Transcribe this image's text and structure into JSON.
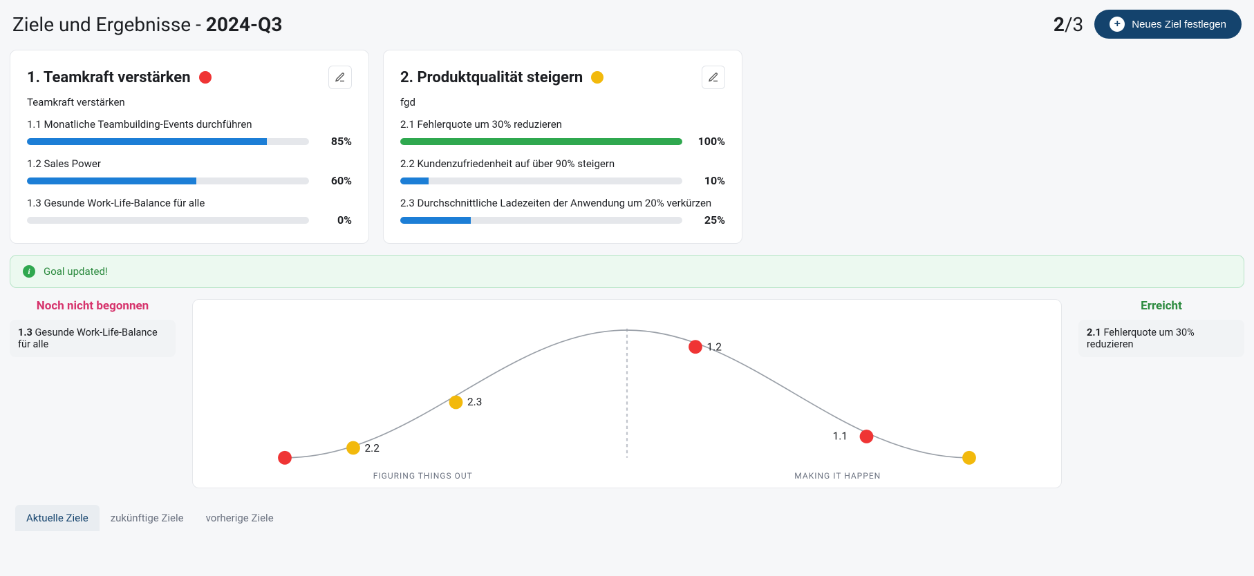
{
  "header": {
    "title_prefix": "Ziele und Ergebnisse - ",
    "period": "2024-Q3",
    "counter_num": "2",
    "counter_total": "/3",
    "new_goal_label": "Neues Ziel festlegen"
  },
  "goals": [
    {
      "title": "1. Teamkraft verstärken",
      "status_color": "red",
      "desc": "Teamkraft verstärken",
      "krs": [
        {
          "label": "1.1 Monatliche Teambuilding-Events durchführen",
          "pct": 85,
          "color": "blue"
        },
        {
          "label": "1.2 Sales Power",
          "pct": 60,
          "color": "blue"
        },
        {
          "label": "1.3 Gesunde Work-Life-Balance für alle",
          "pct": 0,
          "color": "blue"
        }
      ]
    },
    {
      "title": "2. Produktqualität steigern",
      "status_color": "yellow",
      "desc": "fgd",
      "krs": [
        {
          "label": "2.1 Fehlerquote um 30% reduzieren",
          "pct": 100,
          "color": "green"
        },
        {
          "label": "2.2 Kundenzufriedenheit auf über 90% steigern",
          "pct": 10,
          "color": "blue"
        },
        {
          "label": "2.3 Durchschnittliche Ladezeiten der Anwendung um 20% verkürzen",
          "pct": 25,
          "color": "blue"
        }
      ]
    }
  ],
  "alert": {
    "text": "Goal updated!"
  },
  "viz": {
    "not_started_title": "Noch nicht begonnen",
    "not_started_item_id": "1.3",
    "not_started_item_text": " Gesunde Work-Life-Balance für alle",
    "done_title": "Erreicht",
    "done_item_id": "2.1",
    "done_item_text": " Fehlerquote um 30% reduzieren",
    "left_label": "FIGURING THINGS OUT",
    "right_label": "MAKING IT HAPPEN"
  },
  "tabs": {
    "current": "Aktuelle Ziele",
    "future": "zukünftige Ziele",
    "previous": "vorherige Ziele"
  },
  "chart_data": {
    "type": "scatter",
    "title": "",
    "xlabel_left": "FIGURING THINGS OUT",
    "xlabel_right": "MAKING IT HAPPEN",
    "x_range": [
      0,
      100
    ],
    "curve_description": "bell-shaped progress curve from 0% to 100%",
    "points": [
      {
        "id": "1.3",
        "x": 0,
        "goal_color": "red",
        "label_shown": false
      },
      {
        "id": "2.2",
        "x": 10,
        "goal_color": "yellow",
        "label_shown": true,
        "label": "2.2"
      },
      {
        "id": "2.3",
        "x": 25,
        "goal_color": "yellow",
        "label_shown": true,
        "label": "2.3"
      },
      {
        "id": "1.2",
        "x": 60,
        "goal_color": "red",
        "label_shown": true,
        "label": "1.2"
      },
      {
        "id": "1.1",
        "x": 85,
        "goal_color": "red",
        "label_shown": true,
        "label": "1.1"
      },
      {
        "id": "2.1",
        "x": 100,
        "goal_color": "yellow",
        "label_shown": false
      }
    ]
  }
}
